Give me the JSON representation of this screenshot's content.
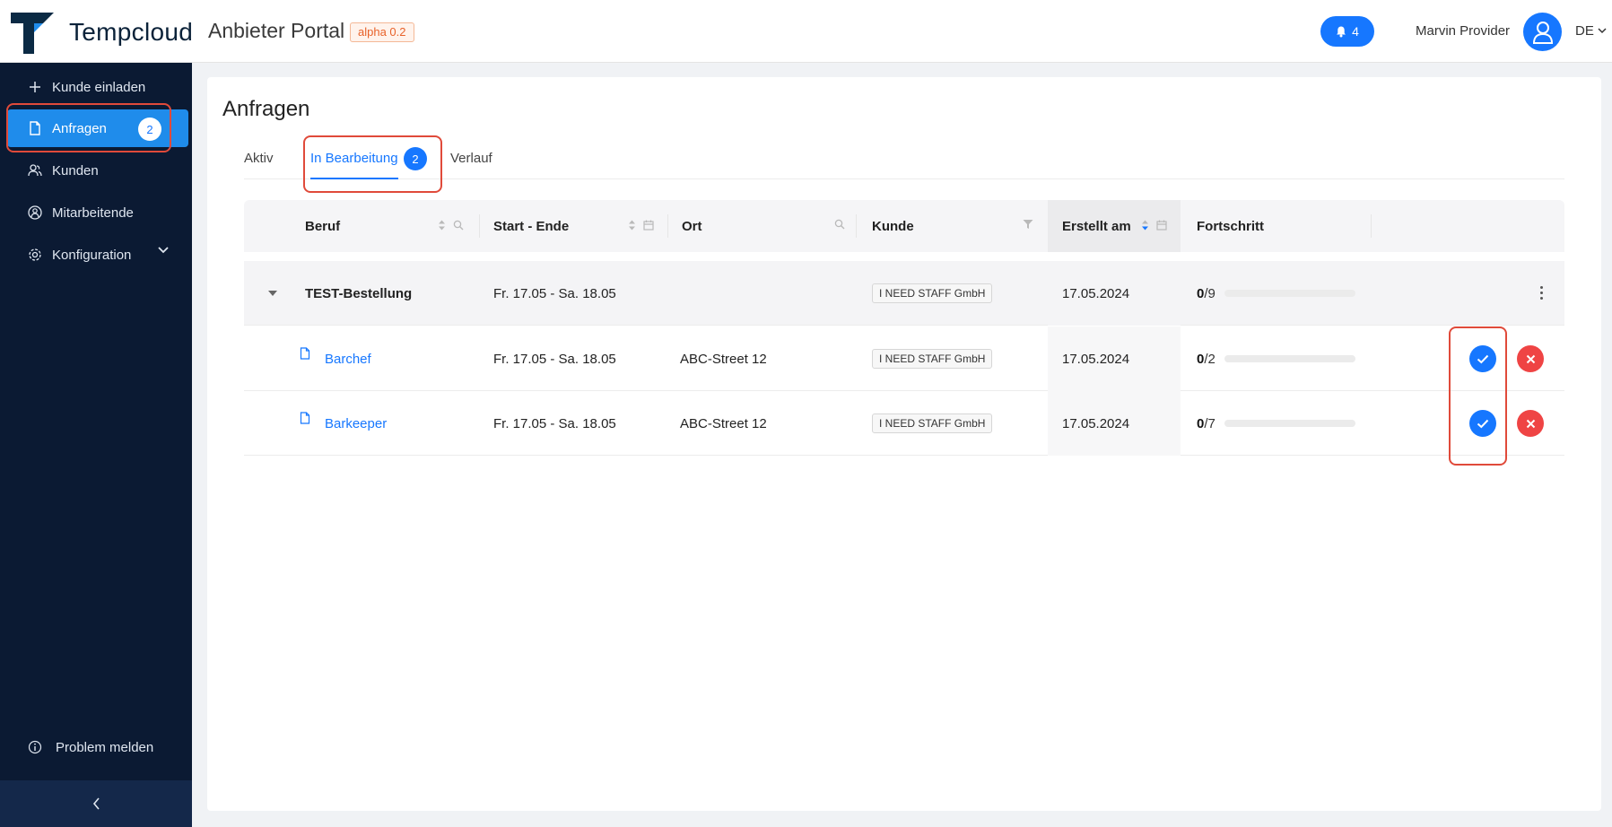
{
  "header": {
    "brand": "Tempcloud",
    "portal_title": "Anbieter Portal",
    "version_badge": "alpha 0.2",
    "notification_count": "4",
    "user_name": "Marvin Provider",
    "language": "DE"
  },
  "sidebar": {
    "items": [
      {
        "label": "Kunde einladen",
        "icon": "plus-icon"
      },
      {
        "label": "Anfragen",
        "icon": "file-icon",
        "badge": "2",
        "active": true
      },
      {
        "label": "Kunden",
        "icon": "users-icon"
      },
      {
        "label": "Mitarbeitende",
        "icon": "team-icon"
      },
      {
        "label": "Konfiguration",
        "icon": "gear-icon"
      }
    ],
    "footer_item": {
      "label": "Problem melden",
      "icon": "info-icon"
    },
    "collapse_icon": "chevron-left-icon"
  },
  "main": {
    "title": "Anfragen",
    "tabs": [
      {
        "label": "Aktiv"
      },
      {
        "label": "In Bearbeitung",
        "badge": "2",
        "active": true
      },
      {
        "label": "Verlauf"
      }
    ],
    "table": {
      "columns": [
        "Beruf",
        "Start - Ende",
        "Ort",
        "Kunde",
        "Erstellt am",
        "Fortschritt"
      ],
      "group": {
        "name": "TEST-Bestellung",
        "period": "Fr. 17.05 - Sa. 18.05",
        "customer": "I NEED STAFF GmbH",
        "created": "17.05.2024",
        "progress_done": "0",
        "progress_total": "/9",
        "progress_fraction": 0
      },
      "rows": [
        {
          "job": "Barchef",
          "period": "Fr. 17.05 - Sa. 18.05",
          "location": "ABC-Street 12",
          "customer": "I NEED STAFF GmbH",
          "created": "17.05.2024",
          "progress_done": "0",
          "progress_total": "/2",
          "progress_fraction": 0
        },
        {
          "job": "Barkeeper",
          "period": "Fr. 17.05 - Sa. 18.05",
          "location": "ABC-Street 12",
          "customer": "I NEED STAFF GmbH",
          "created": "17.05.2024",
          "progress_done": "0",
          "progress_total": "/7",
          "progress_fraction": 0
        }
      ]
    }
  },
  "colors": {
    "primary": "#1677ff",
    "sidebar_bg": "#0b1a33",
    "sidebar_active": "#1f8ceb",
    "reject": "#ef4444",
    "highlight_outline": "#e04a3a",
    "version_badge": "#e8622a"
  }
}
